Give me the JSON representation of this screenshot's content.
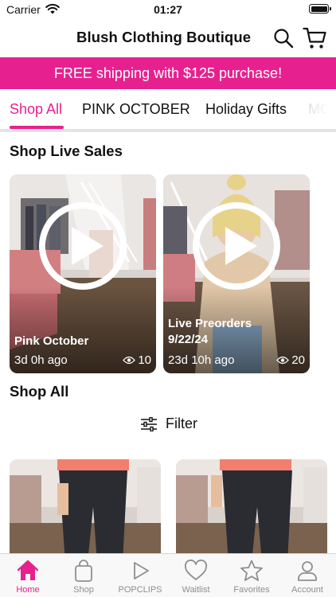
{
  "status_bar": {
    "carrier": "Carrier",
    "time": "01:27"
  },
  "header": {
    "title": "Blush Clothing Boutique",
    "icons": [
      "search-icon",
      "cart-icon"
    ]
  },
  "promo": {
    "text": "FREE shipping with $125 purchase!"
  },
  "category_tabs": [
    {
      "label": "Shop All",
      "active": true
    },
    {
      "label": "PINK OCTOBER",
      "active": false
    },
    {
      "label": "Holiday Gifts",
      "active": false
    },
    {
      "label": "MO",
      "active": false
    }
  ],
  "live_sales": {
    "title": "Shop Live Sales",
    "items": [
      {
        "name": "Pink October",
        "ago": "3d 0h ago",
        "views": "10"
      },
      {
        "name": "Live Preorders 9/22/24",
        "ago": "23d 10h ago",
        "views": "20"
      }
    ]
  },
  "shop_all": {
    "title": "Shop All",
    "filter_label": "Filter"
  },
  "tab_bar": [
    {
      "label": "Home",
      "icon": "home-icon",
      "active": true
    },
    {
      "label": "Shop",
      "icon": "bag-icon",
      "active": false
    },
    {
      "label": "POPCLIPS",
      "icon": "play-icon",
      "active": false
    },
    {
      "label": "Waitlist",
      "icon": "heart-icon",
      "active": false
    },
    {
      "label": "Favorites",
      "icon": "star-icon",
      "active": false
    },
    {
      "label": "Account",
      "icon": "person-icon",
      "active": false
    }
  ],
  "colors": {
    "accent": "#e6218f",
    "inactive": "#8e8e93"
  }
}
